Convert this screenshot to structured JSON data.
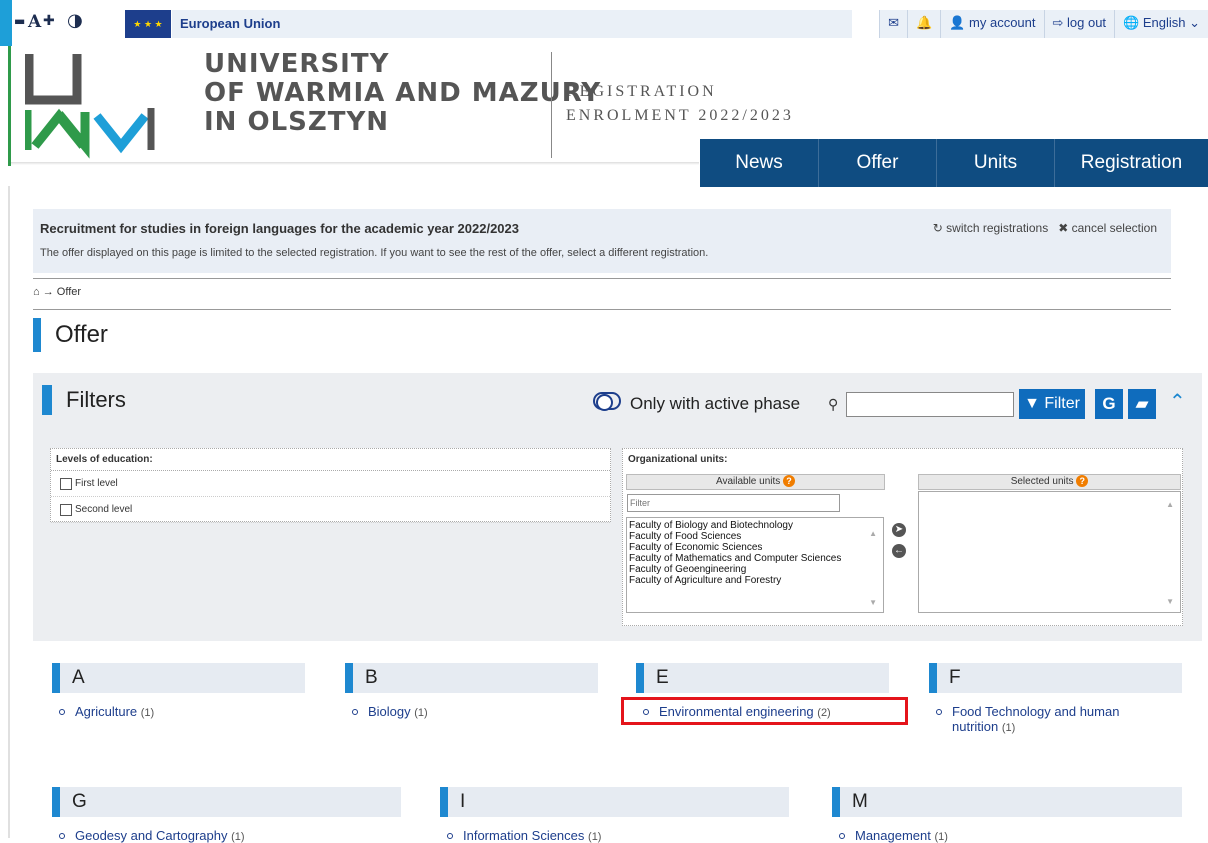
{
  "topbar": {
    "acc_minus": "▬",
    "acc_a": "A",
    "acc_plus": "✚",
    "acc_contrast": "◑",
    "eu_label": "European Union",
    "right_items": [
      {
        "id": "messages",
        "label": "✉"
      },
      {
        "id": "notifications",
        "label": "🔔"
      },
      {
        "id": "account",
        "label": "👤 my account"
      },
      {
        "id": "logout",
        "label": "⇨ log out"
      },
      {
        "id": "language",
        "label": "🌐 English ⌄"
      }
    ]
  },
  "header": {
    "uni_line1": "UNIVERSITY",
    "uni_line2": "OF WARMIA AND MAZURY",
    "uni_line3": "IN OLSZTYN",
    "reg_line1": "REGISTRATION",
    "reg_line2": "ENROLMENT 2022/2023"
  },
  "nav": {
    "items": [
      "News",
      "Offer",
      "Units",
      "Registration"
    ]
  },
  "notice": {
    "title": "Recruitment for studies in foreign languages for the academic year 2022/2023",
    "desc": "The offer displayed on this page is limited to the selected registration. If you want to see the rest of the offer, select a different registration.",
    "switch": "↻ switch registrations",
    "cancel": "✖ cancel selection"
  },
  "breadcrumb": {
    "home": "⌂",
    "arrow": "→",
    "current": "Offer"
  },
  "page_title": "Offer",
  "filters": {
    "title": "Filters",
    "active_phase": "Only with active phase",
    "search_icon": "🔍",
    "filter_btn": "▼ Filter",
    "g_btn": "G",
    "eraser_btn": "▰",
    "collapse": "˄",
    "levels": {
      "heading": "Levels of education:",
      "options": [
        "First level",
        "Second level"
      ]
    },
    "units": {
      "heading": "Organizational units:",
      "available_label": "Available units",
      "selected_label": "Selected units",
      "filter_placeholder": "Filter",
      "list": [
        "Faculty of Biology and Biotechnology",
        "Faculty of Food Sciences",
        "Faculty of Economic Sciences",
        "Faculty of Mathematics and Computer Sciences",
        "Faculty of Geoengineering",
        "Faculty of Agriculture and Forestry"
      ]
    }
  },
  "offer": {
    "groups": [
      {
        "letter": "A",
        "items": [
          {
            "name": "Agriculture",
            "count": "(1)"
          }
        ]
      },
      {
        "letter": "B",
        "items": [
          {
            "name": "Biology",
            "count": "(1)"
          }
        ]
      },
      {
        "letter": "E",
        "items": [
          {
            "name": "Environmental engineering",
            "count": "(2)"
          }
        ]
      },
      {
        "letter": "F",
        "items": [
          {
            "name": "Food Technology and human nutrition",
            "count": "(1)"
          }
        ]
      },
      {
        "letter": "G",
        "items": [
          {
            "name": "Geodesy and Cartography",
            "count": "(1)"
          }
        ]
      },
      {
        "letter": "I",
        "items": [
          {
            "name": "Information Sciences",
            "count": "(1)"
          }
        ]
      },
      {
        "letter": "M",
        "items": [
          {
            "name": "Management",
            "count": "(1)"
          }
        ]
      }
    ]
  },
  "colors": {
    "brand": "#0f4c81",
    "accent": "#1e88d0",
    "highlight": "#e4141b"
  }
}
